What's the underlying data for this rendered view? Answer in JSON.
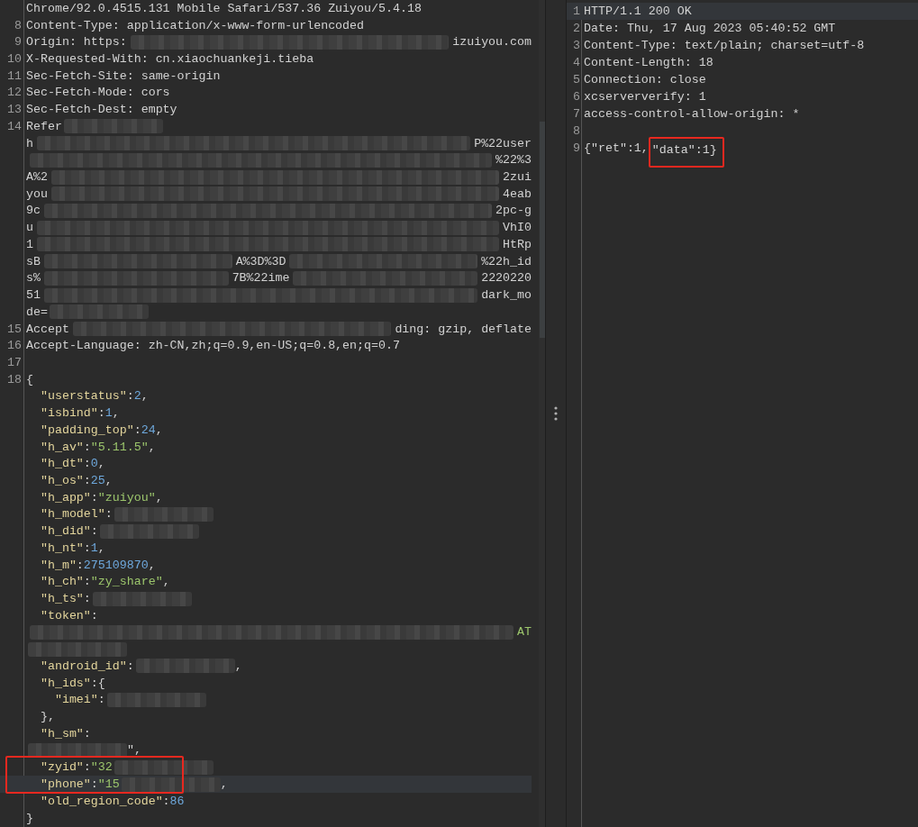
{
  "request": {
    "lines": [
      {
        "kind": "line",
        "tokens": [
          {
            "kind": "plain",
            "t": "Chrome/92.0.4515.131 Mobile Safari/537.36 Zuiyou/5.4.18"
          }
        ]
      },
      {
        "kind": "line",
        "number": "8",
        "tokens": [
          {
            "kind": "plain",
            "t": "Content-Type: application/x-www-form-urlencoded"
          }
        ]
      },
      {
        "kind": "line",
        "number": "9",
        "tokens": [
          {
            "kind": "plain",
            "t": "Origin: https:"
          },
          {
            "kind": "redacted"
          },
          {
            "kind": "plain",
            "t": "izuiyou.com"
          }
        ]
      },
      {
        "kind": "line",
        "number": "10",
        "tokens": [
          {
            "kind": "plain",
            "t": "X-Requested-With: cn.xiaochuankeji.tieba"
          }
        ]
      },
      {
        "kind": "line",
        "number": "11",
        "tokens": [
          {
            "kind": "plain",
            "t": "Sec-Fetch-Site: same-origin"
          }
        ]
      },
      {
        "kind": "line",
        "number": "12",
        "tokens": [
          {
            "kind": "plain",
            "t": "Sec-Fetch-Mode: cors"
          }
        ]
      },
      {
        "kind": "line",
        "number": "13",
        "tokens": [
          {
            "kind": "plain",
            "t": "Sec-Fetch-Dest: empty"
          }
        ]
      },
      {
        "kind": "line",
        "number": "14",
        "tokens": [
          {
            "kind": "plain",
            "t": "Refer"
          },
          {
            "kind": "redacted"
          }
        ]
      },
      {
        "kind": "line",
        "tokens": [
          {
            "kind": "plain",
            "t": "h"
          },
          {
            "kind": "redacted"
          },
          {
            "kind": "plain",
            "t": "P%22user"
          }
        ]
      },
      {
        "kind": "line",
        "tokens": [
          {
            "kind": "redacted"
          },
          {
            "kind": "plain",
            "t": "%22%3"
          }
        ]
      },
      {
        "kind": "line",
        "tokens": [
          {
            "kind": "plain",
            "t": "A%2"
          },
          {
            "kind": "redacted"
          },
          {
            "kind": "plain",
            "t": "2zui"
          }
        ]
      },
      {
        "kind": "line",
        "tokens": [
          {
            "kind": "plain",
            "t": "you"
          },
          {
            "kind": "redacted"
          },
          {
            "kind": "plain",
            "t": "4eab"
          }
        ]
      },
      {
        "kind": "line",
        "tokens": [
          {
            "kind": "plain",
            "t": "9c"
          },
          {
            "kind": "redacted"
          },
          {
            "kind": "plain",
            "t": "2pc-g"
          }
        ]
      },
      {
        "kind": "line",
        "tokens": [
          {
            "kind": "plain",
            "t": "u"
          },
          {
            "kind": "redacted"
          },
          {
            "kind": "plain",
            "t": "VhI0"
          }
        ]
      },
      {
        "kind": "line",
        "tokens": [
          {
            "kind": "plain",
            "t": "1"
          },
          {
            "kind": "redacted"
          },
          {
            "kind": "plain",
            "t": "HtRp"
          }
        ]
      },
      {
        "kind": "line",
        "tokens": [
          {
            "kind": "plain",
            "t": "sB"
          },
          {
            "kind": "redacted"
          },
          {
            "kind": "plain",
            "t": "A%3D%3D"
          },
          {
            "kind": "redacted"
          },
          {
            "kind": "plain",
            "t": "%22h_id"
          }
        ]
      },
      {
        "kind": "line",
        "tokens": [
          {
            "kind": "plain",
            "t": "s%"
          },
          {
            "kind": "redacted"
          },
          {
            "kind": "plain",
            "t": "7B%22ime"
          },
          {
            "kind": "redacted"
          },
          {
            "kind": "plain",
            "t": "2220220"
          }
        ]
      },
      {
        "kind": "line",
        "tokens": [
          {
            "kind": "plain",
            "t": "51"
          },
          {
            "kind": "redacted"
          },
          {
            "kind": "plain",
            "t": "dark_mo"
          }
        ]
      },
      {
        "kind": "line",
        "tokens": [
          {
            "kind": "plain",
            "t": "de="
          },
          {
            "kind": "redacted"
          }
        ]
      },
      {
        "kind": "line",
        "number": "15",
        "tokens": [
          {
            "kind": "plain",
            "t": "Accept"
          },
          {
            "kind": "redacted"
          },
          {
            "kind": "plain",
            "t": "ding: gzip, deflate"
          }
        ]
      },
      {
        "kind": "line",
        "number": "16",
        "tokens": [
          {
            "kind": "plain",
            "t": "Accept-Language: zh-CN,zh;q=0.9,en-US;q=0.8,en;q=0.7"
          }
        ]
      },
      {
        "kind": "line",
        "number": "17"
      },
      {
        "kind": "line",
        "number": "18",
        "tokens": [
          {
            "kind": "plain",
            "t": "{"
          }
        ]
      },
      {
        "kind": "line",
        "tokens": [
          {
            "kind": "key",
            "t": "  \"userstatus\""
          },
          {
            "kind": "plain",
            "t": ":"
          },
          {
            "kind": "num",
            "t": "2"
          },
          {
            "kind": "plain",
            "t": ","
          }
        ]
      },
      {
        "kind": "line",
        "tokens": [
          {
            "kind": "key",
            "t": "  \"isbind\""
          },
          {
            "kind": "plain",
            "t": ":"
          },
          {
            "kind": "num",
            "t": "1"
          },
          {
            "kind": "plain",
            "t": ","
          }
        ]
      },
      {
        "kind": "line",
        "tokens": [
          {
            "kind": "key",
            "t": "  \"padding_top\""
          },
          {
            "kind": "plain",
            "t": ":"
          },
          {
            "kind": "num",
            "t": "24"
          },
          {
            "kind": "plain",
            "t": ","
          }
        ]
      },
      {
        "kind": "line",
        "tokens": [
          {
            "kind": "key",
            "t": "  \"h_av\""
          },
          {
            "kind": "plain",
            "t": ":"
          },
          {
            "kind": "str",
            "t": "\"5.11.5\""
          },
          {
            "kind": "plain",
            "t": ","
          }
        ]
      },
      {
        "kind": "line",
        "tokens": [
          {
            "kind": "key",
            "t": "  \"h_dt\""
          },
          {
            "kind": "plain",
            "t": ":"
          },
          {
            "kind": "num",
            "t": "0"
          },
          {
            "kind": "plain",
            "t": ","
          }
        ]
      },
      {
        "kind": "line",
        "tokens": [
          {
            "kind": "key",
            "t": "  \"h_os\""
          },
          {
            "kind": "plain",
            "t": ":"
          },
          {
            "kind": "num",
            "t": "25"
          },
          {
            "kind": "plain",
            "t": ","
          }
        ]
      },
      {
        "kind": "line",
        "tokens": [
          {
            "kind": "key",
            "t": "  \"h_app\""
          },
          {
            "kind": "plain",
            "t": ":"
          },
          {
            "kind": "str",
            "t": "\"zuiyou\""
          },
          {
            "kind": "plain",
            "t": ","
          }
        ]
      },
      {
        "kind": "line",
        "tokens": [
          {
            "kind": "key",
            "t": "  \"h_model\""
          },
          {
            "kind": "plain",
            "t": ":"
          },
          {
            "kind": "redacted"
          }
        ]
      },
      {
        "kind": "line",
        "tokens": [
          {
            "kind": "key",
            "t": "  \"h_did\""
          },
          {
            "kind": "plain",
            "t": ":"
          },
          {
            "kind": "redacted"
          }
        ]
      },
      {
        "kind": "line",
        "tokens": [
          {
            "kind": "key",
            "t": "  \"h_nt\""
          },
          {
            "kind": "plain",
            "t": ":"
          },
          {
            "kind": "num",
            "t": "1"
          },
          {
            "kind": "plain",
            "t": ","
          }
        ]
      },
      {
        "kind": "line",
        "tokens": [
          {
            "kind": "key",
            "t": "  \"h_m\""
          },
          {
            "kind": "plain",
            "t": ":"
          },
          {
            "kind": "num",
            "t": "275109870"
          },
          {
            "kind": "plain",
            "t": ","
          }
        ]
      },
      {
        "kind": "line",
        "tokens": [
          {
            "kind": "key",
            "t": "  \"h_ch\""
          },
          {
            "kind": "plain",
            "t": ":"
          },
          {
            "kind": "str",
            "t": "\"zy_share\""
          },
          {
            "kind": "plain",
            "t": ","
          }
        ]
      },
      {
        "kind": "line",
        "tokens": [
          {
            "kind": "key",
            "t": "  \"h_ts\""
          },
          {
            "kind": "plain",
            "t": ":"
          },
          {
            "kind": "redacted"
          }
        ]
      },
      {
        "kind": "line",
        "tokens": [
          {
            "kind": "key",
            "t": "  \"token\""
          },
          {
            "kind": "plain",
            "t": ":"
          }
        ]
      },
      {
        "kind": "line",
        "tokens": [
          {
            "kind": "redacted"
          },
          {
            "kind": "str",
            "t": "AT"
          }
        ]
      },
      {
        "kind": "line",
        "tokens": [
          {
            "kind": "redacted"
          }
        ]
      },
      {
        "kind": "line",
        "tokens": [
          {
            "kind": "key",
            "t": "  \"android_id\""
          },
          {
            "kind": "plain",
            "t": ":"
          },
          {
            "kind": "redacted"
          },
          {
            "kind": "plain",
            "t": ","
          }
        ]
      },
      {
        "kind": "line",
        "tokens": [
          {
            "kind": "key",
            "t": "  \"h_ids\""
          },
          {
            "kind": "plain",
            "t": ":{"
          }
        ]
      },
      {
        "kind": "line",
        "tokens": [
          {
            "kind": "key",
            "t": "    \"imei\""
          },
          {
            "kind": "plain",
            "t": ":"
          },
          {
            "kind": "redacted"
          }
        ]
      },
      {
        "kind": "line",
        "tokens": [
          {
            "kind": "plain",
            "t": "  },"
          }
        ]
      },
      {
        "kind": "line",
        "tokens": [
          {
            "kind": "key",
            "t": "  \"h_sm\""
          },
          {
            "kind": "plain",
            "t": ":"
          }
        ]
      },
      {
        "kind": "line",
        "tokens": [
          {
            "kind": "redacted"
          },
          {
            "kind": "plain",
            "t": "\","
          }
        ]
      },
      {
        "kind": "box",
        "lines": [
          {
            "current": false,
            "tokens": [
              {
                "kind": "key",
                "t": "  \"zyid\""
              },
              {
                "kind": "plain",
                "t": ":"
              },
              {
                "kind": "str",
                "t": "\"32"
              },
              {
                "kind": "redacted"
              }
            ]
          },
          {
            "current": true,
            "tokens": [
              {
                "kind": "key",
                "t": "  \"phone\""
              },
              {
                "kind": "plain",
                "t": ":"
              },
              {
                "kind": "str",
                "t": "\"15"
              },
              {
                "kind": "redacted"
              },
              {
                "kind": "plain",
                "t": ","
              }
            ]
          }
        ]
      },
      {
        "kind": "line",
        "tokens": [
          {
            "kind": "key",
            "t": "  \"old_region_code\""
          },
          {
            "kind": "plain",
            "t": ":"
          },
          {
            "kind": "num",
            "t": "86"
          }
        ]
      },
      {
        "kind": "line",
        "tokens": [
          {
            "kind": "plain",
            "t": "}"
          }
        ]
      }
    ]
  },
  "response": {
    "lines": [
      {
        "kind": "line",
        "number": "1",
        "current": true,
        "tokens": [
          {
            "kind": "plain",
            "t": "HTTP/1.1 200 OK"
          }
        ]
      },
      {
        "kind": "line",
        "number": "2",
        "current": false,
        "tokens": [
          {
            "kind": "plain",
            "t": "Date: Thu, 17 Aug 2023 05:40:52 GMT"
          }
        ]
      },
      {
        "kind": "line",
        "number": "3",
        "tokens": [
          {
            "kind": "plain",
            "t": "Content-Type: text/plain; charset=utf-8"
          }
        ]
      },
      {
        "kind": "line",
        "number": "4",
        "tokens": [
          {
            "kind": "plain",
            "t": "Content-Length: 18"
          }
        ]
      },
      {
        "kind": "line",
        "number": "5",
        "tokens": [
          {
            "kind": "plain",
            "t": "Connection: close"
          }
        ]
      },
      {
        "kind": "line",
        "number": "6",
        "tokens": [
          {
            "kind": "plain",
            "t": "xcserververify: 1"
          }
        ]
      },
      {
        "kind": "line",
        "number": "7",
        "tokens": [
          {
            "kind": "plain",
            "t": "access-control-allow-origin: *"
          }
        ]
      },
      {
        "kind": "line",
        "number": "8"
      },
      {
        "kind": "line",
        "number": "9",
        "tokens": [
          {
            "kind": "plain",
            "t": "{\"ret\":1,"
          },
          {
            "kind": "box",
            "tokens": [
              {
                "kind": "plain",
                "t": "\"data\":1}"
              }
            ]
          }
        ]
      }
    ]
  }
}
